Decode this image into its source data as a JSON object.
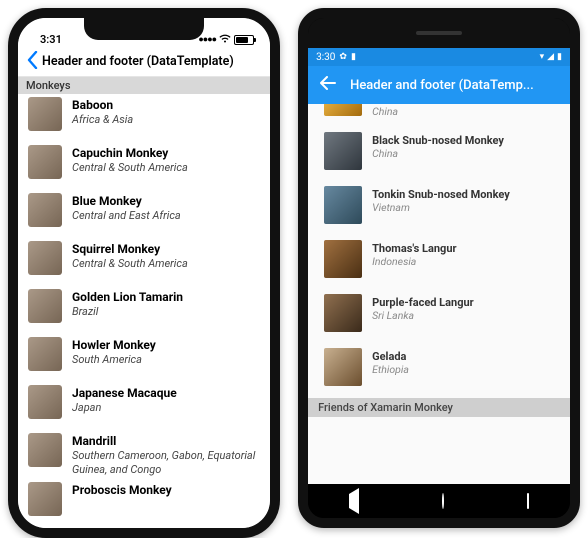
{
  "ios": {
    "status_time": "3:31",
    "nav_title": "Header and footer (DataTemplate)",
    "list_header": "Monkeys",
    "items": [
      {
        "name": "Baboon",
        "location": "Africa & Asia"
      },
      {
        "name": "Capuchin Monkey",
        "location": "Central & South America"
      },
      {
        "name": "Blue Monkey",
        "location": "Central and East Africa"
      },
      {
        "name": "Squirrel Monkey",
        "location": "Central & South America"
      },
      {
        "name": "Golden Lion Tamarin",
        "location": "Brazil"
      },
      {
        "name": "Howler Monkey",
        "location": "South America"
      },
      {
        "name": "Japanese Macaque",
        "location": "Japan"
      },
      {
        "name": "Mandrill",
        "location": "Southern Cameroon, Gabon, Equatorial Guinea, and Congo"
      },
      {
        "name": "Proboscis Monkey",
        "location": ""
      }
    ]
  },
  "android": {
    "status_time": "3:30",
    "app_title": "Header and footer (DataTemp...",
    "list_footer": "Friends of Xamarin Monkey",
    "items": [
      {
        "name": "",
        "location": "China"
      },
      {
        "name": "Black Snub-nosed Monkey",
        "location": "China"
      },
      {
        "name": "Tonkin Snub-nosed Monkey",
        "location": "Vietnam"
      },
      {
        "name": "Thomas's Langur",
        "location": "Indonesia"
      },
      {
        "name": "Purple-faced Langur",
        "location": "Sri Lanka"
      },
      {
        "name": "Gelada",
        "location": "Ethiopia"
      }
    ]
  }
}
